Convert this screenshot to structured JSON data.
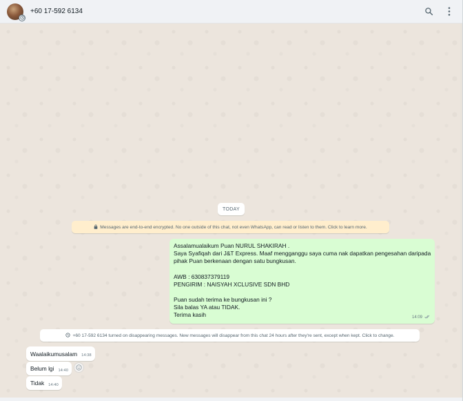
{
  "header": {
    "contact_name": "+60 17-592 6134",
    "avatar_icon": "profile-photo",
    "status_icon": "disappearing-timer-icon",
    "search_icon": "search-icon",
    "menu_icon": "more-vertical-icon"
  },
  "chat": {
    "date_label": "TODAY",
    "encryption_notice": "Messages are end-to-end encrypted. No one outside of this chat, not even WhatsApp, can read or listen to them. Click to learn more.",
    "outgoing_message": {
      "lines": [
        "Assalamualaikum Puan NURUL SHAKIRAH .",
        "Saya Syafiqah dari J&T Express. Maaf mengganggu saya cuma nak dapatkan pengesahan daripada",
        "pihak Puan berkenaan dengan satu bungkusan.",
        "",
        "AWB : 630837379119",
        "PENGIRIM : NAISYAH XCLUSIVE SDN BHD",
        "",
        "Puan sudah terima ke bungkusan ini ?",
        "Sila balas YA atau TIDAK.",
        "Terima kasih"
      ],
      "time": "14:09",
      "status": "read"
    },
    "system_notice": "+60 17-592 6134 turned on disappearing messages. New messages will disappear from this chat 24 hours after they're sent, except when kept. Click to change.",
    "incoming_messages": [
      {
        "text": "Waalaikumusalam",
        "time": "14:38"
      },
      {
        "text": "Belum lgi",
        "time": "14:40"
      },
      {
        "text": "Tidak",
        "time": "14:40"
      }
    ]
  },
  "colors": {
    "outgoing_bubble": "#d9fdd3",
    "incoming_bubble": "#ffffff",
    "notice_bg": "#ffeecd",
    "chat_background": "#efeae2",
    "read_ticks": "#53bdeb"
  }
}
